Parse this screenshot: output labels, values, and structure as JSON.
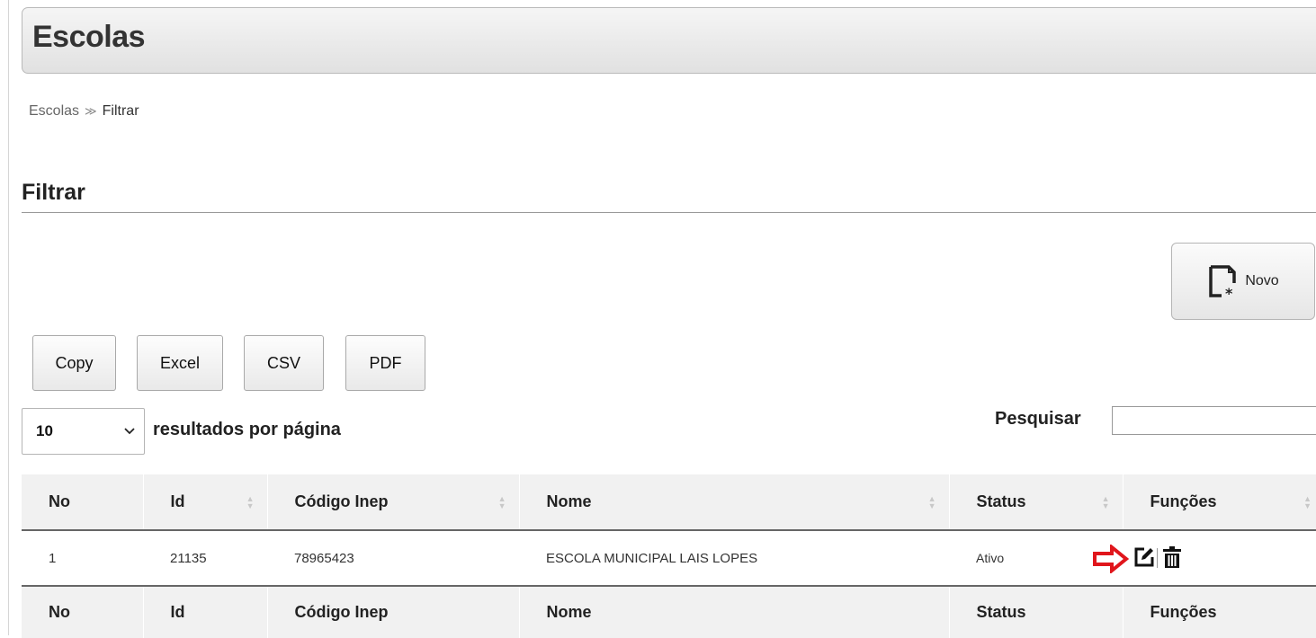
{
  "header": {
    "title": "Escolas"
  },
  "breadcrumb": {
    "root": "Escolas",
    "separator": "≫",
    "current": "Filtrar"
  },
  "section": {
    "title": "Filtrar"
  },
  "novo_button": {
    "label": "Novo",
    "icon": "new-document-icon"
  },
  "export_buttons": [
    {
      "label": "Copy"
    },
    {
      "label": "Excel"
    },
    {
      "label": "CSV"
    },
    {
      "label": "PDF"
    }
  ],
  "length": {
    "value": "10",
    "label": "resultados por página"
  },
  "search": {
    "label": "Pesquisar",
    "value": ""
  },
  "table": {
    "columns": [
      "No",
      "Id",
      "Código Inep",
      "Nome",
      "Status",
      "Funções"
    ],
    "rows": [
      {
        "no": "1",
        "id": "21135",
        "inep": "78965423",
        "nome": "ESCOLA MUNICIPAL LAIS LOPES",
        "status": "Ativo"
      }
    ]
  },
  "colors": {
    "annotation_arrow": "#e0161c"
  },
  "icons": [
    "new-document-icon",
    "chevron-down-icon",
    "sort-icon",
    "arrow-right-icon",
    "edit-icon",
    "trash-icon"
  ]
}
